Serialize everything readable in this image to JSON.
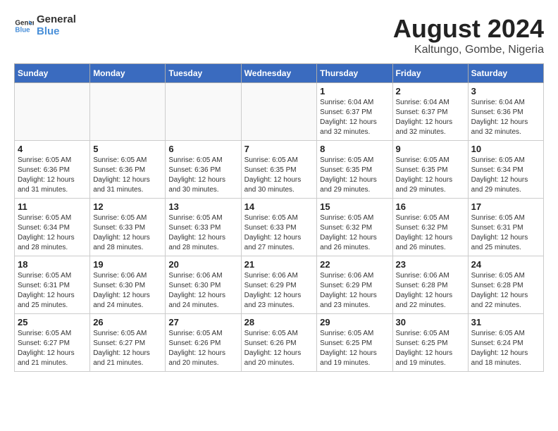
{
  "header": {
    "logo_line1": "General",
    "logo_line2": "Blue",
    "month_year": "August 2024",
    "location": "Kaltungo, Gombe, Nigeria"
  },
  "weekdays": [
    "Sunday",
    "Monday",
    "Tuesday",
    "Wednesday",
    "Thursday",
    "Friday",
    "Saturday"
  ],
  "weeks": [
    [
      {
        "day": "",
        "info": ""
      },
      {
        "day": "",
        "info": ""
      },
      {
        "day": "",
        "info": ""
      },
      {
        "day": "",
        "info": ""
      },
      {
        "day": "1",
        "info": "Sunrise: 6:04 AM\nSunset: 6:37 PM\nDaylight: 12 hours\nand 32 minutes."
      },
      {
        "day": "2",
        "info": "Sunrise: 6:04 AM\nSunset: 6:37 PM\nDaylight: 12 hours\nand 32 minutes."
      },
      {
        "day": "3",
        "info": "Sunrise: 6:04 AM\nSunset: 6:36 PM\nDaylight: 12 hours\nand 32 minutes."
      }
    ],
    [
      {
        "day": "4",
        "info": "Sunrise: 6:05 AM\nSunset: 6:36 PM\nDaylight: 12 hours\nand 31 minutes."
      },
      {
        "day": "5",
        "info": "Sunrise: 6:05 AM\nSunset: 6:36 PM\nDaylight: 12 hours\nand 31 minutes."
      },
      {
        "day": "6",
        "info": "Sunrise: 6:05 AM\nSunset: 6:36 PM\nDaylight: 12 hours\nand 30 minutes."
      },
      {
        "day": "7",
        "info": "Sunrise: 6:05 AM\nSunset: 6:35 PM\nDaylight: 12 hours\nand 30 minutes."
      },
      {
        "day": "8",
        "info": "Sunrise: 6:05 AM\nSunset: 6:35 PM\nDaylight: 12 hours\nand 29 minutes."
      },
      {
        "day": "9",
        "info": "Sunrise: 6:05 AM\nSunset: 6:35 PM\nDaylight: 12 hours\nand 29 minutes."
      },
      {
        "day": "10",
        "info": "Sunrise: 6:05 AM\nSunset: 6:34 PM\nDaylight: 12 hours\nand 29 minutes."
      }
    ],
    [
      {
        "day": "11",
        "info": "Sunrise: 6:05 AM\nSunset: 6:34 PM\nDaylight: 12 hours\nand 28 minutes."
      },
      {
        "day": "12",
        "info": "Sunrise: 6:05 AM\nSunset: 6:33 PM\nDaylight: 12 hours\nand 28 minutes."
      },
      {
        "day": "13",
        "info": "Sunrise: 6:05 AM\nSunset: 6:33 PM\nDaylight: 12 hours\nand 28 minutes."
      },
      {
        "day": "14",
        "info": "Sunrise: 6:05 AM\nSunset: 6:33 PM\nDaylight: 12 hours\nand 27 minutes."
      },
      {
        "day": "15",
        "info": "Sunrise: 6:05 AM\nSunset: 6:32 PM\nDaylight: 12 hours\nand 26 minutes."
      },
      {
        "day": "16",
        "info": "Sunrise: 6:05 AM\nSunset: 6:32 PM\nDaylight: 12 hours\nand 26 minutes."
      },
      {
        "day": "17",
        "info": "Sunrise: 6:05 AM\nSunset: 6:31 PM\nDaylight: 12 hours\nand 25 minutes."
      }
    ],
    [
      {
        "day": "18",
        "info": "Sunrise: 6:05 AM\nSunset: 6:31 PM\nDaylight: 12 hours\nand 25 minutes."
      },
      {
        "day": "19",
        "info": "Sunrise: 6:06 AM\nSunset: 6:30 PM\nDaylight: 12 hours\nand 24 minutes."
      },
      {
        "day": "20",
        "info": "Sunrise: 6:06 AM\nSunset: 6:30 PM\nDaylight: 12 hours\nand 24 minutes."
      },
      {
        "day": "21",
        "info": "Sunrise: 6:06 AM\nSunset: 6:29 PM\nDaylight: 12 hours\nand 23 minutes."
      },
      {
        "day": "22",
        "info": "Sunrise: 6:06 AM\nSunset: 6:29 PM\nDaylight: 12 hours\nand 23 minutes."
      },
      {
        "day": "23",
        "info": "Sunrise: 6:06 AM\nSunset: 6:28 PM\nDaylight: 12 hours\nand 22 minutes."
      },
      {
        "day": "24",
        "info": "Sunrise: 6:05 AM\nSunset: 6:28 PM\nDaylight: 12 hours\nand 22 minutes."
      }
    ],
    [
      {
        "day": "25",
        "info": "Sunrise: 6:05 AM\nSunset: 6:27 PM\nDaylight: 12 hours\nand 21 minutes."
      },
      {
        "day": "26",
        "info": "Sunrise: 6:05 AM\nSunset: 6:27 PM\nDaylight: 12 hours\nand 21 minutes."
      },
      {
        "day": "27",
        "info": "Sunrise: 6:05 AM\nSunset: 6:26 PM\nDaylight: 12 hours\nand 20 minutes."
      },
      {
        "day": "28",
        "info": "Sunrise: 6:05 AM\nSunset: 6:26 PM\nDaylight: 12 hours\nand 20 minutes."
      },
      {
        "day": "29",
        "info": "Sunrise: 6:05 AM\nSunset: 6:25 PM\nDaylight: 12 hours\nand 19 minutes."
      },
      {
        "day": "30",
        "info": "Sunrise: 6:05 AM\nSunset: 6:25 PM\nDaylight: 12 hours\nand 19 minutes."
      },
      {
        "day": "31",
        "info": "Sunrise: 6:05 AM\nSunset: 6:24 PM\nDaylight: 12 hours\nand 18 minutes."
      }
    ]
  ]
}
